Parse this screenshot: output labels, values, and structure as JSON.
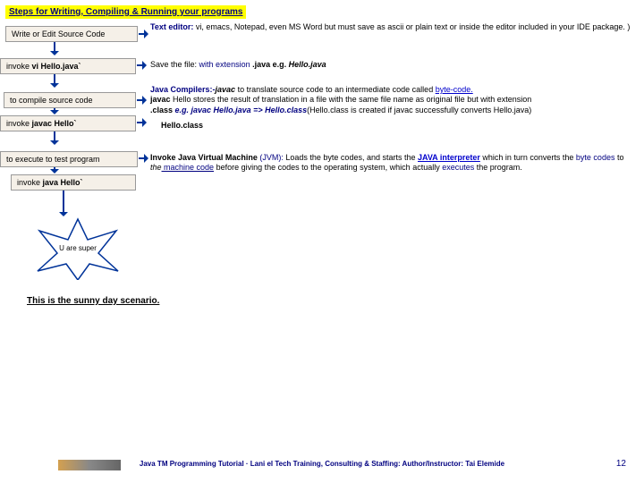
{
  "title": "Steps for Writing, Compiling & Running your programs",
  "boxes": {
    "write": "Write or Edit Source Code",
    "invoke_vi_pre": "invoke ",
    "invoke_vi_cmd": "vi Hello.java`",
    "compile": "to compile source code",
    "invoke_javac_pre": "invoke ",
    "invoke_javac_cmd": "javac Hello`",
    "execute": "to execute to test program",
    "invoke_java_pre": "invoke ",
    "invoke_java_cmd": "java Hello`"
  },
  "desc1": {
    "label": "Text editor:",
    "rest": " vi, emacs, Notepad, even MS Word but must save as ascii or plain text or inside the editor included in your IDE package. )"
  },
  "desc2": {
    "pre": "Save the file: ",
    "mid": "with extension ",
    "ext": ".java e.g. ",
    "eg": "Hello.java"
  },
  "desc3": {
    "l1a": "Java Compilers:-",
    "l1b": "javac",
    "l1c": " to translate source code to an intermediate code called ",
    "l1d": "byte-code.",
    "l2a": "javac",
    "l2b": " Hello stores the result of translation in a file with the same file name as original file but with extension ",
    "l3a": ".class",
    "l3b": "  e.g. javac Hello.java => Hello.class",
    "l3c": "(Hello.class is created if javac successfully converts Hello.java)",
    "l4": "Hello.class"
  },
  "desc4": {
    "a": "Invoke Java Virtual Machine ",
    "b": "(JVM):",
    "c": " Loads the byte codes, and starts the ",
    "d": "JAVA interpreter",
    "e": " which in turn converts the ",
    "f": "byte codes",
    "g": " to ",
    "h": "the",
    "i": " machine code",
    "j": " before giving the codes to the operating system, which actually ",
    "k": "executes",
    "l": " the program."
  },
  "star": "U are super",
  "sunny": "This is the sunny day scenario.",
  "footer": "Java TM Programming Tutorial  ·  Lani el Tech Training, Consulting & Staffing: Author/Instructor: Tai Elemide",
  "page": "12"
}
